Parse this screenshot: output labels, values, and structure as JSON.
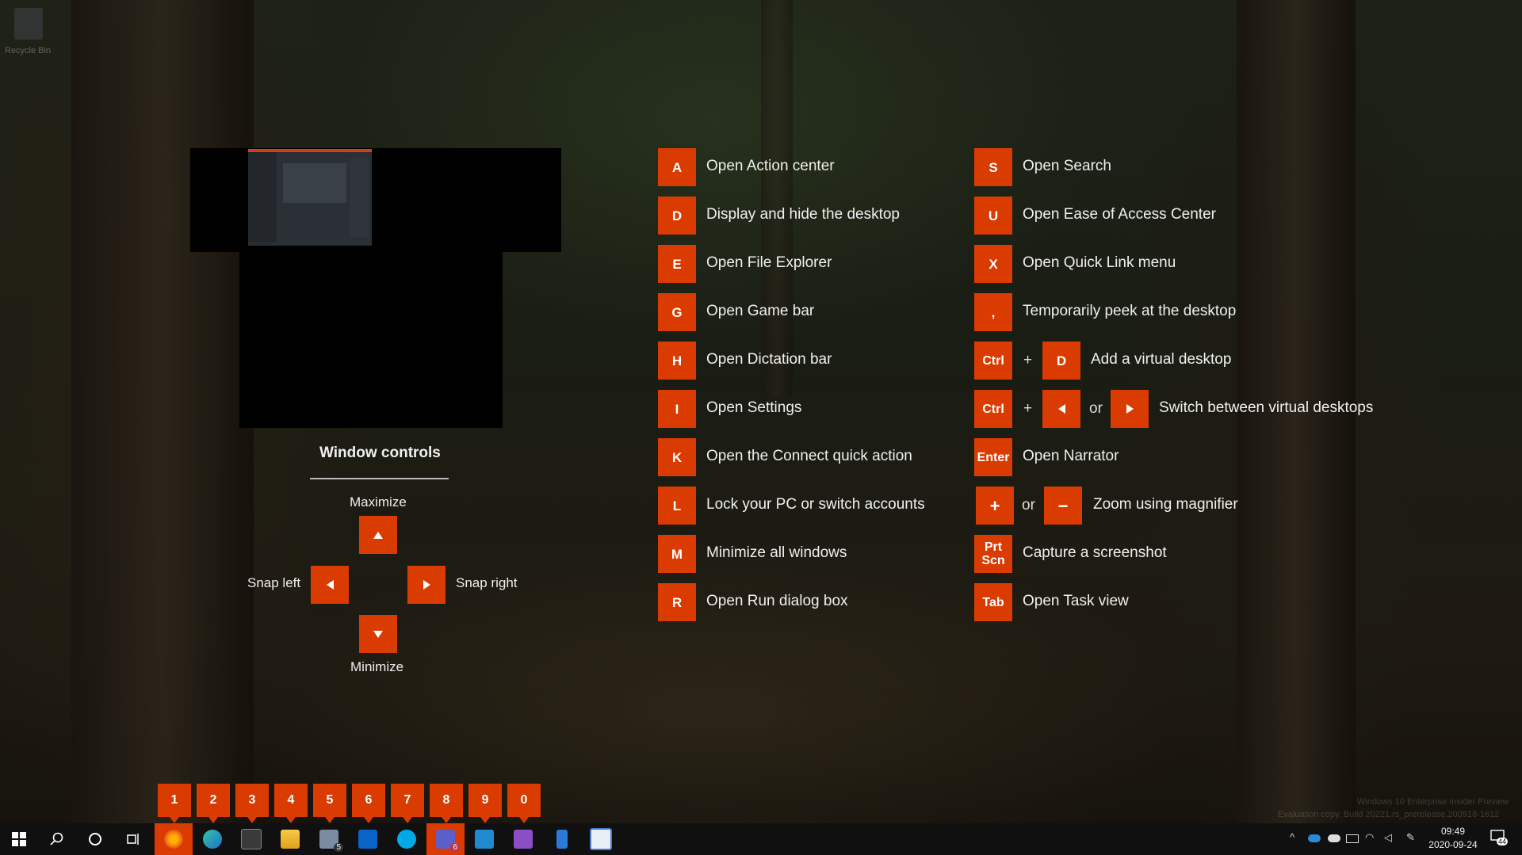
{
  "desktop": {
    "recycle_bin_label": "Recycle Bin"
  },
  "window_controls": {
    "title": "Window controls",
    "maximize": "Maximize",
    "minimize": "Minimize",
    "snap_left": "Snap left",
    "snap_right": "Snap right"
  },
  "shortcuts_left": [
    {
      "key": "A",
      "label": "Open Action center"
    },
    {
      "key": "D",
      "label": "Display and hide the desktop"
    },
    {
      "key": "E",
      "label": "Open File Explorer"
    },
    {
      "key": "G",
      "label": "Open Game bar"
    },
    {
      "key": "H",
      "label": "Open Dictation bar"
    },
    {
      "key": "I",
      "label": "Open Settings"
    },
    {
      "key": "K",
      "label": "Open the Connect quick action"
    },
    {
      "key": "L",
      "label": "Lock your PC or switch accounts"
    },
    {
      "key": "M",
      "label": "Minimize all windows"
    },
    {
      "key": "R",
      "label": "Open Run dialog box"
    }
  ],
  "shortcuts_right": {
    "s": {
      "key": "S",
      "label": "Open Search"
    },
    "u": {
      "key": "U",
      "label": "Open Ease of Access Center"
    },
    "x": {
      "key": "X",
      "label": "Open Quick Link menu"
    },
    "comma": {
      "key": ",",
      "label": "Temporarily peek at the desktop"
    },
    "ctrl_d": {
      "key1": "Ctrl",
      "plus": "+",
      "key2": "D",
      "label": "Add a virtual desktop"
    },
    "ctrl_arrows": {
      "key1": "Ctrl",
      "plus": "+",
      "or": "or",
      "label": "Switch between virtual desktops"
    },
    "enter": {
      "key": "Enter",
      "label": "Open Narrator"
    },
    "zoom": {
      "key1": "+",
      "or": "or",
      "key2": "−",
      "label": "Zoom using magnifier"
    },
    "prtscn": {
      "key_line1": "Prt",
      "key_line2": "Scn",
      "label": "Capture a screenshot"
    },
    "tab": {
      "key": "Tab",
      "label": "Open Task view"
    }
  },
  "taskbar_numbers": [
    "1",
    "2",
    "3",
    "4",
    "5",
    "6",
    "7",
    "8",
    "9",
    "0"
  ],
  "taskbar": {
    "apps": [
      "start-icon",
      "search-icon",
      "cortana-icon",
      "task-view-icon",
      "firefox-icon",
      "edge-icon",
      "terminal-icon",
      "file-explorer-icon",
      "mail-icon",
      "outlook-icon",
      "skype-icon",
      "teams-icon",
      "vscode-icon",
      "visual-studio-icon",
      "phone-icon",
      "snip-icon"
    ],
    "mail_badge": "5",
    "teams_badge": "6",
    "time": "09:49",
    "date": "2020-09-24",
    "notification_count": "44"
  },
  "watermark": {
    "line1": "Windows 10 Enterprise Insider Preview",
    "line2": "Evaluation copy. Build 20221.rs_prerelease.200918-1612"
  },
  "colors": {
    "accent": "#da3b01",
    "taskbar": "#101010"
  }
}
